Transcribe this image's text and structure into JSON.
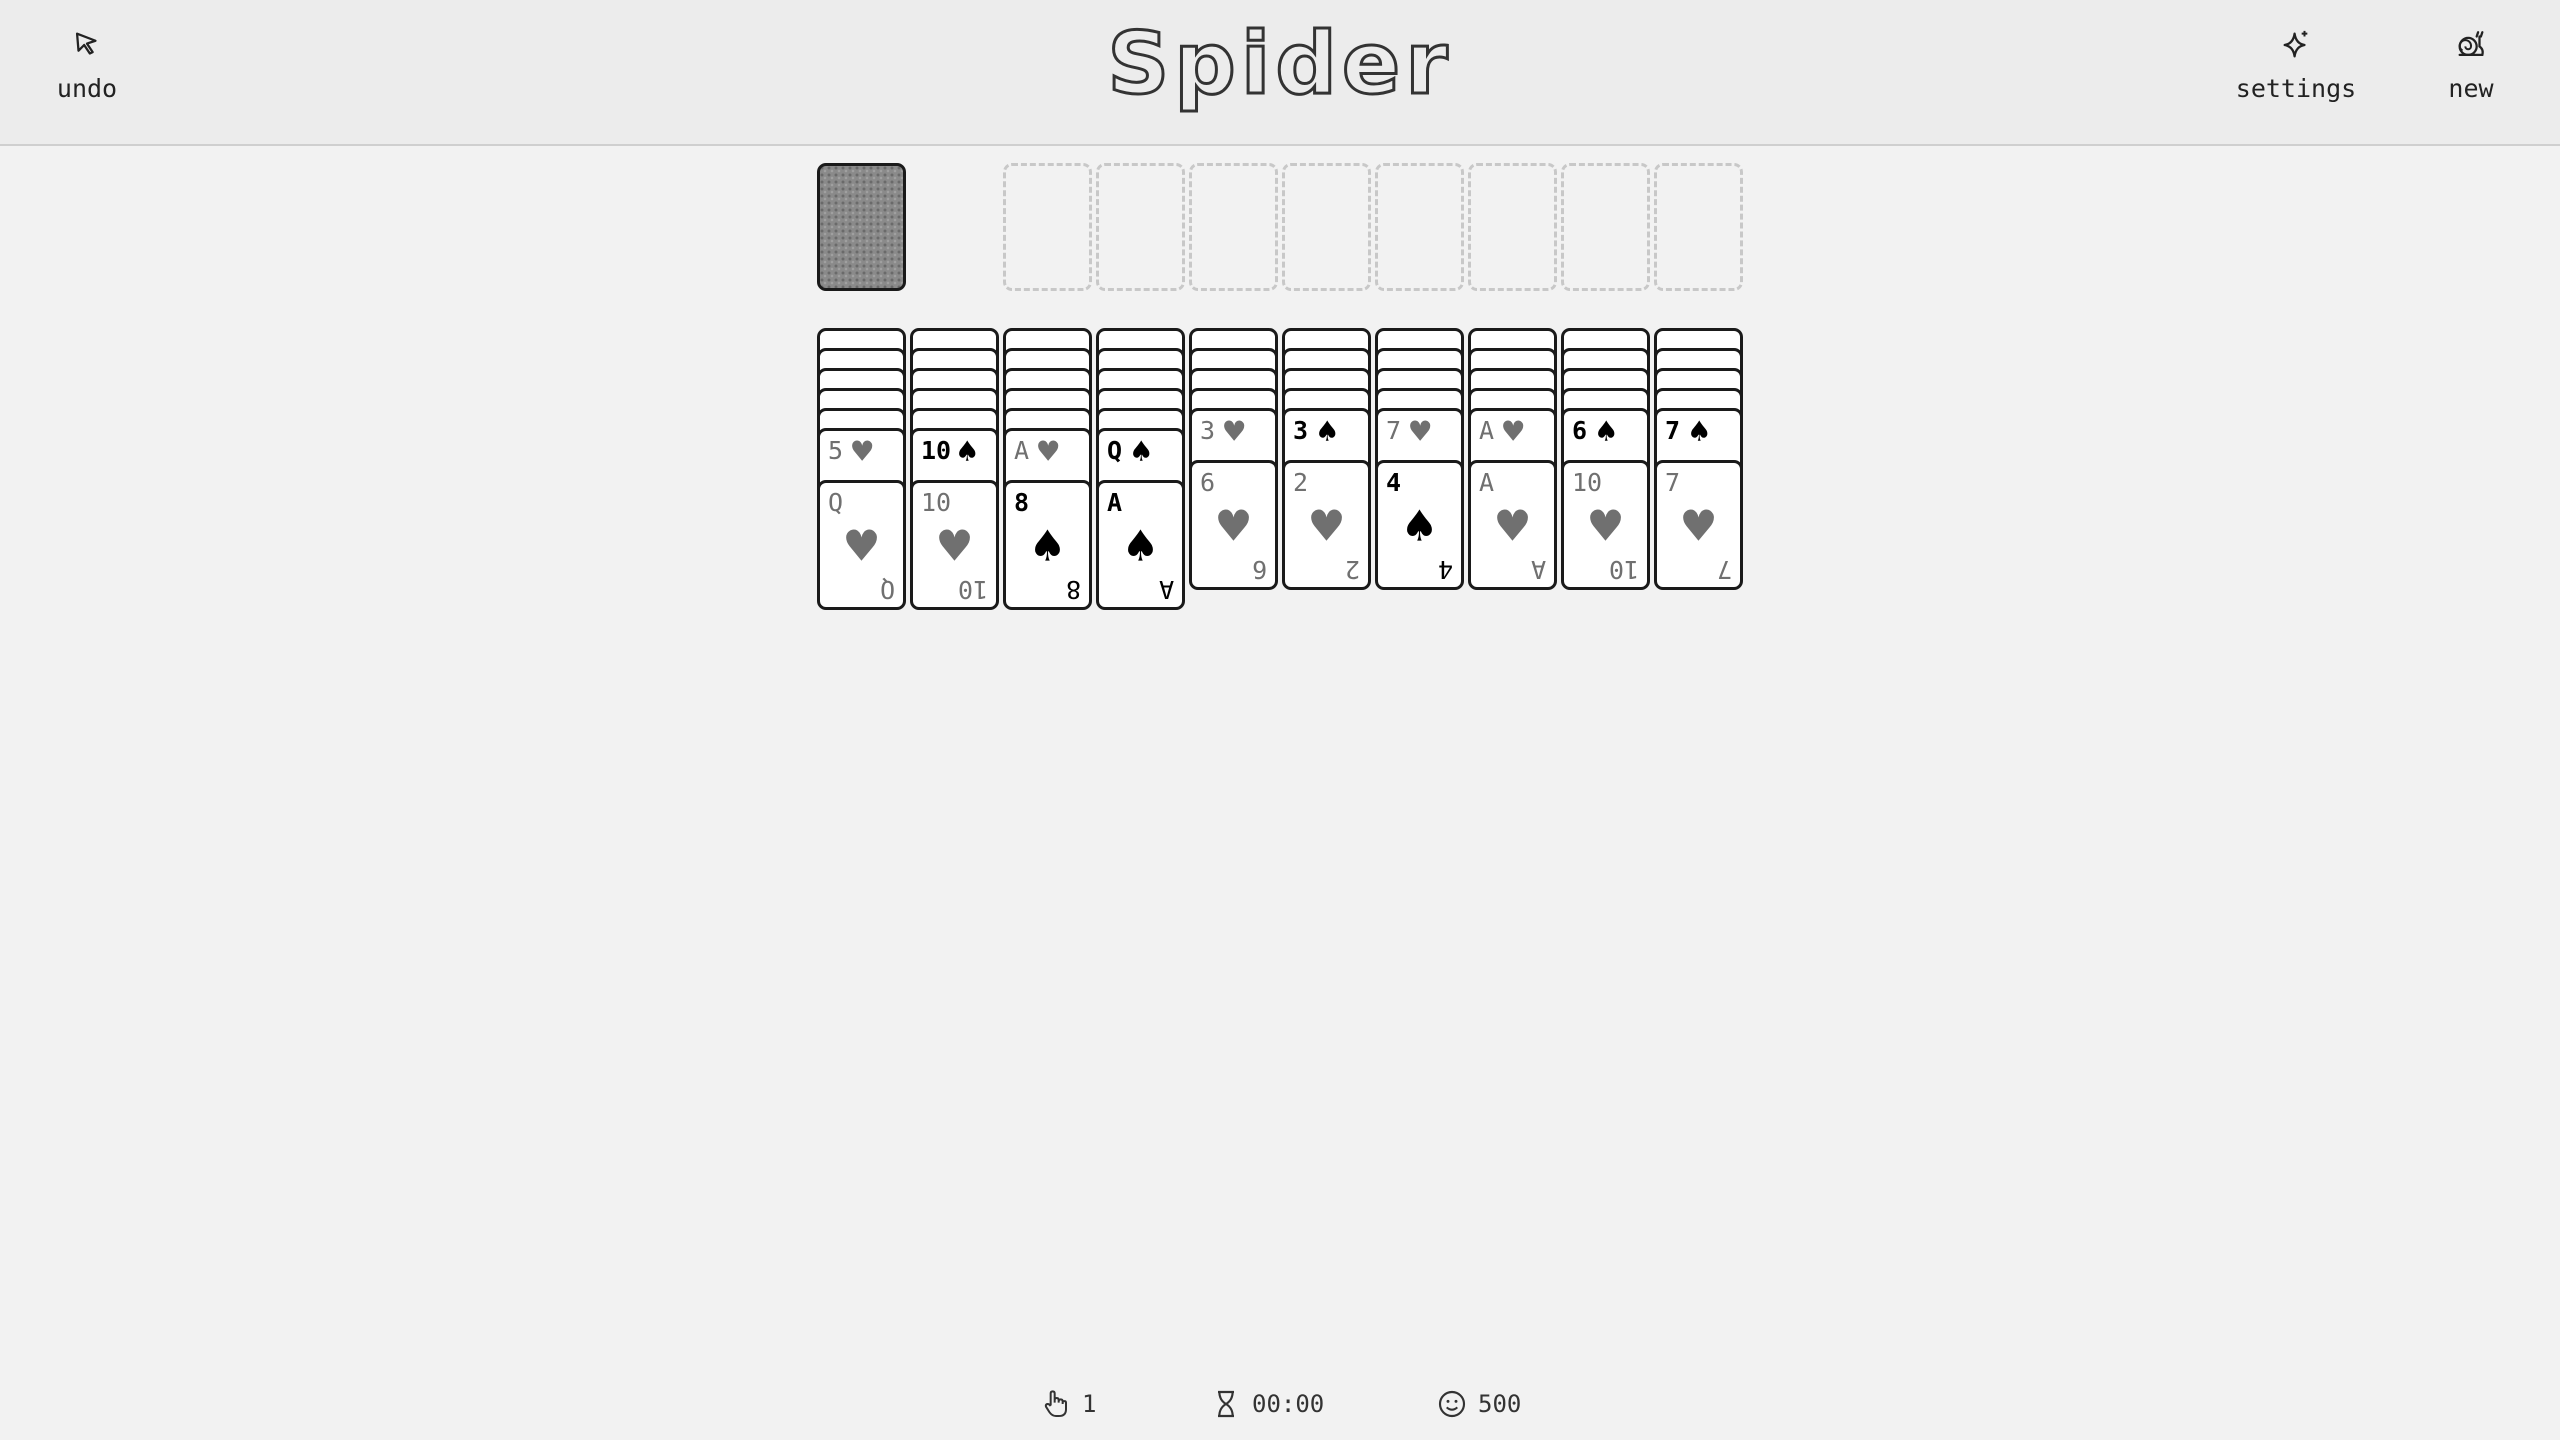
{
  "header": {
    "title": "Spider",
    "undo_label": "undo",
    "settings_label": "settings",
    "new_label": "new"
  },
  "stock": {
    "icon": "card-back"
  },
  "foundations": {
    "count": 8
  },
  "tableau": [
    {
      "face_down": 5,
      "face_up": [
        {
          "rank": "5",
          "suit": "heart"
        },
        {
          "rank": "Q",
          "suit": "heart"
        }
      ]
    },
    {
      "face_down": 5,
      "face_up": [
        {
          "rank": "10",
          "suit": "spade"
        },
        {
          "rank": "10",
          "suit": "heart"
        }
      ]
    },
    {
      "face_down": 5,
      "face_up": [
        {
          "rank": "A",
          "suit": "heart"
        },
        {
          "rank": "8",
          "suit": "spade"
        }
      ]
    },
    {
      "face_down": 5,
      "face_up": [
        {
          "rank": "Q",
          "suit": "spade"
        },
        {
          "rank": "A",
          "suit": "spade"
        }
      ]
    },
    {
      "face_down": 4,
      "face_up": [
        {
          "rank": "3",
          "suit": "heart"
        },
        {
          "rank": "6",
          "suit": "heart"
        }
      ]
    },
    {
      "face_down": 4,
      "face_up": [
        {
          "rank": "3",
          "suit": "spade"
        },
        {
          "rank": "2",
          "suit": "heart"
        }
      ]
    },
    {
      "face_down": 4,
      "face_up": [
        {
          "rank": "7",
          "suit": "heart"
        },
        {
          "rank": "4",
          "suit": "spade"
        }
      ]
    },
    {
      "face_down": 4,
      "face_up": [
        {
          "rank": "A",
          "suit": "heart"
        },
        {
          "rank": "A",
          "suit": "heart"
        }
      ]
    },
    {
      "face_down": 4,
      "face_up": [
        {
          "rank": "6",
          "suit": "spade"
        },
        {
          "rank": "10",
          "suit": "heart"
        }
      ]
    },
    {
      "face_down": 4,
      "face_up": [
        {
          "rank": "7",
          "suit": "spade"
        },
        {
          "rank": "7",
          "suit": "heart"
        }
      ]
    }
  ],
  "colors": {
    "heart": "#707070",
    "spade": "#000000"
  },
  "status": {
    "moves": "1",
    "time": "00:00",
    "score": "500",
    "moves_icon": "hand-icon",
    "time_icon": "hourglass-icon",
    "score_icon": "smiley-icon"
  }
}
